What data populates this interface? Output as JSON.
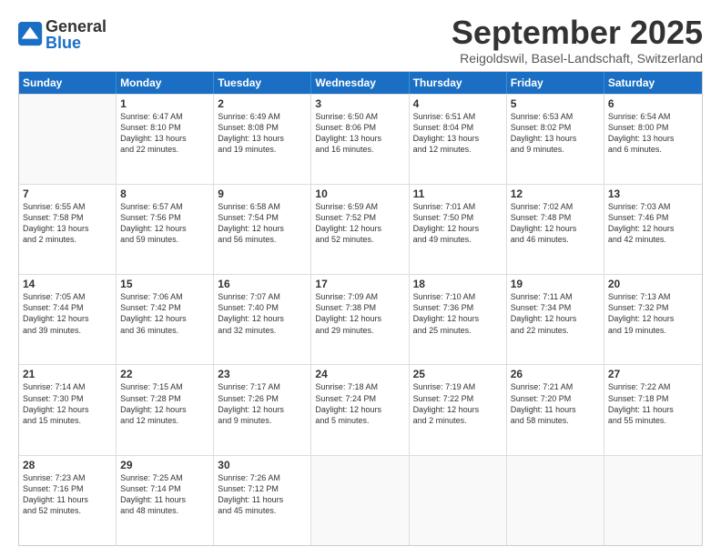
{
  "logo": {
    "general": "General",
    "blue": "Blue"
  },
  "title": "September 2025",
  "location": "Reigoldswil, Basel-Landschaft, Switzerland",
  "header_days": [
    "Sunday",
    "Monday",
    "Tuesday",
    "Wednesday",
    "Thursday",
    "Friday",
    "Saturday"
  ],
  "weeks": [
    [
      {
        "day": "",
        "lines": []
      },
      {
        "day": "1",
        "lines": [
          "Sunrise: 6:47 AM",
          "Sunset: 8:10 PM",
          "Daylight: 13 hours",
          "and 22 minutes."
        ]
      },
      {
        "day": "2",
        "lines": [
          "Sunrise: 6:49 AM",
          "Sunset: 8:08 PM",
          "Daylight: 13 hours",
          "and 19 minutes."
        ]
      },
      {
        "day": "3",
        "lines": [
          "Sunrise: 6:50 AM",
          "Sunset: 8:06 PM",
          "Daylight: 13 hours",
          "and 16 minutes."
        ]
      },
      {
        "day": "4",
        "lines": [
          "Sunrise: 6:51 AM",
          "Sunset: 8:04 PM",
          "Daylight: 13 hours",
          "and 12 minutes."
        ]
      },
      {
        "day": "5",
        "lines": [
          "Sunrise: 6:53 AM",
          "Sunset: 8:02 PM",
          "Daylight: 13 hours",
          "and 9 minutes."
        ]
      },
      {
        "day": "6",
        "lines": [
          "Sunrise: 6:54 AM",
          "Sunset: 8:00 PM",
          "Daylight: 13 hours",
          "and 6 minutes."
        ]
      }
    ],
    [
      {
        "day": "7",
        "lines": [
          "Sunrise: 6:55 AM",
          "Sunset: 7:58 PM",
          "Daylight: 13 hours",
          "and 2 minutes."
        ]
      },
      {
        "day": "8",
        "lines": [
          "Sunrise: 6:57 AM",
          "Sunset: 7:56 PM",
          "Daylight: 12 hours",
          "and 59 minutes."
        ]
      },
      {
        "day": "9",
        "lines": [
          "Sunrise: 6:58 AM",
          "Sunset: 7:54 PM",
          "Daylight: 12 hours",
          "and 56 minutes."
        ]
      },
      {
        "day": "10",
        "lines": [
          "Sunrise: 6:59 AM",
          "Sunset: 7:52 PM",
          "Daylight: 12 hours",
          "and 52 minutes."
        ]
      },
      {
        "day": "11",
        "lines": [
          "Sunrise: 7:01 AM",
          "Sunset: 7:50 PM",
          "Daylight: 12 hours",
          "and 49 minutes."
        ]
      },
      {
        "day": "12",
        "lines": [
          "Sunrise: 7:02 AM",
          "Sunset: 7:48 PM",
          "Daylight: 12 hours",
          "and 46 minutes."
        ]
      },
      {
        "day": "13",
        "lines": [
          "Sunrise: 7:03 AM",
          "Sunset: 7:46 PM",
          "Daylight: 12 hours",
          "and 42 minutes."
        ]
      }
    ],
    [
      {
        "day": "14",
        "lines": [
          "Sunrise: 7:05 AM",
          "Sunset: 7:44 PM",
          "Daylight: 12 hours",
          "and 39 minutes."
        ]
      },
      {
        "day": "15",
        "lines": [
          "Sunrise: 7:06 AM",
          "Sunset: 7:42 PM",
          "Daylight: 12 hours",
          "and 36 minutes."
        ]
      },
      {
        "day": "16",
        "lines": [
          "Sunrise: 7:07 AM",
          "Sunset: 7:40 PM",
          "Daylight: 12 hours",
          "and 32 minutes."
        ]
      },
      {
        "day": "17",
        "lines": [
          "Sunrise: 7:09 AM",
          "Sunset: 7:38 PM",
          "Daylight: 12 hours",
          "and 29 minutes."
        ]
      },
      {
        "day": "18",
        "lines": [
          "Sunrise: 7:10 AM",
          "Sunset: 7:36 PM",
          "Daylight: 12 hours",
          "and 25 minutes."
        ]
      },
      {
        "day": "19",
        "lines": [
          "Sunrise: 7:11 AM",
          "Sunset: 7:34 PM",
          "Daylight: 12 hours",
          "and 22 minutes."
        ]
      },
      {
        "day": "20",
        "lines": [
          "Sunrise: 7:13 AM",
          "Sunset: 7:32 PM",
          "Daylight: 12 hours",
          "and 19 minutes."
        ]
      }
    ],
    [
      {
        "day": "21",
        "lines": [
          "Sunrise: 7:14 AM",
          "Sunset: 7:30 PM",
          "Daylight: 12 hours",
          "and 15 minutes."
        ]
      },
      {
        "day": "22",
        "lines": [
          "Sunrise: 7:15 AM",
          "Sunset: 7:28 PM",
          "Daylight: 12 hours",
          "and 12 minutes."
        ]
      },
      {
        "day": "23",
        "lines": [
          "Sunrise: 7:17 AM",
          "Sunset: 7:26 PM",
          "Daylight: 12 hours",
          "and 9 minutes."
        ]
      },
      {
        "day": "24",
        "lines": [
          "Sunrise: 7:18 AM",
          "Sunset: 7:24 PM",
          "Daylight: 12 hours",
          "and 5 minutes."
        ]
      },
      {
        "day": "25",
        "lines": [
          "Sunrise: 7:19 AM",
          "Sunset: 7:22 PM",
          "Daylight: 12 hours",
          "and 2 minutes."
        ]
      },
      {
        "day": "26",
        "lines": [
          "Sunrise: 7:21 AM",
          "Sunset: 7:20 PM",
          "Daylight: 11 hours",
          "and 58 minutes."
        ]
      },
      {
        "day": "27",
        "lines": [
          "Sunrise: 7:22 AM",
          "Sunset: 7:18 PM",
          "Daylight: 11 hours",
          "and 55 minutes."
        ]
      }
    ],
    [
      {
        "day": "28",
        "lines": [
          "Sunrise: 7:23 AM",
          "Sunset: 7:16 PM",
          "Daylight: 11 hours",
          "and 52 minutes."
        ]
      },
      {
        "day": "29",
        "lines": [
          "Sunrise: 7:25 AM",
          "Sunset: 7:14 PM",
          "Daylight: 11 hours",
          "and 48 minutes."
        ]
      },
      {
        "day": "30",
        "lines": [
          "Sunrise: 7:26 AM",
          "Sunset: 7:12 PM",
          "Daylight: 11 hours",
          "and 45 minutes."
        ]
      },
      {
        "day": "",
        "lines": []
      },
      {
        "day": "",
        "lines": []
      },
      {
        "day": "",
        "lines": []
      },
      {
        "day": "",
        "lines": []
      }
    ]
  ]
}
